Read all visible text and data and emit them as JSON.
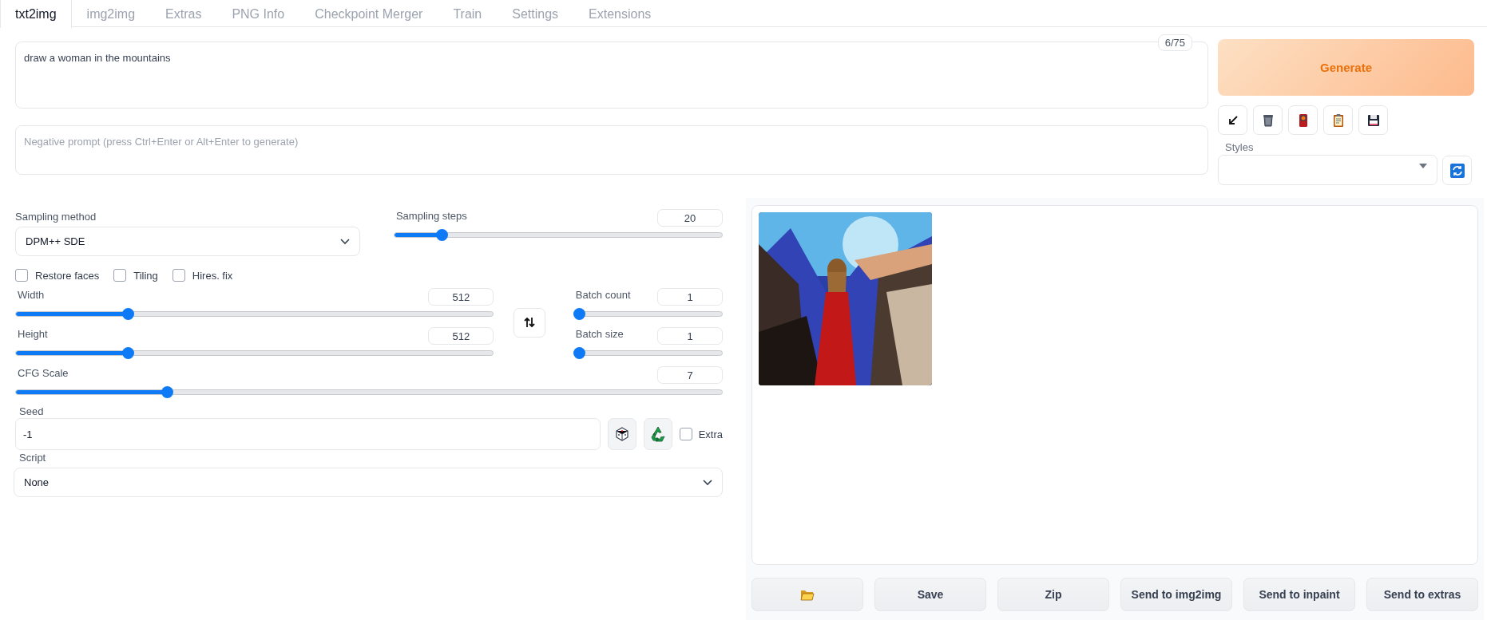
{
  "tabs": [
    {
      "label": "txt2img",
      "selected": true
    },
    {
      "label": "img2img",
      "selected": false
    },
    {
      "label": "Extras",
      "selected": false
    },
    {
      "label": "PNG Info",
      "selected": false
    },
    {
      "label": "Checkpoint Merger",
      "selected": false
    },
    {
      "label": "Train",
      "selected": false
    },
    {
      "label": "Settings",
      "selected": false
    },
    {
      "label": "Extensions",
      "selected": false
    }
  ],
  "prompt": {
    "value": "draw a woman in the mountains",
    "token_count": "6/75"
  },
  "negative_prompt": {
    "placeholder": "Negative prompt (press Ctrl+Enter or Alt+Enter to generate)"
  },
  "generate_button": "Generate",
  "styles": {
    "label": "Styles"
  },
  "sampling_method": {
    "label": "Sampling method",
    "value": "DPM++ SDE"
  },
  "sampling_steps": {
    "label": "Sampling steps",
    "value": "20",
    "level": 0.133
  },
  "checkboxes": [
    {
      "label": "Restore faces",
      "checked": false
    },
    {
      "label": "Tiling",
      "checked": false
    },
    {
      "label": "Hires. fix",
      "checked": false
    }
  ],
  "width": {
    "label": "Width",
    "value": "512",
    "level": 0.23
  },
  "height": {
    "label": "Height",
    "value": "512",
    "level": 0.23
  },
  "batch_count": {
    "label": "Batch count",
    "value": "1",
    "level": 0
  },
  "batch_size": {
    "label": "Batch size",
    "value": "1",
    "level": 0
  },
  "cfg_scale": {
    "label": "CFG Scale",
    "value": "7",
    "level": 0.21
  },
  "seed": {
    "label": "Seed",
    "value": "-1"
  },
  "extra": {
    "label": "Extra",
    "checked": false
  },
  "script": {
    "label": "Script",
    "value": "None"
  },
  "output_buttons": [
    "Save",
    "Zip",
    "Send to img2img",
    "Send to inpaint",
    "Send to extras"
  ]
}
